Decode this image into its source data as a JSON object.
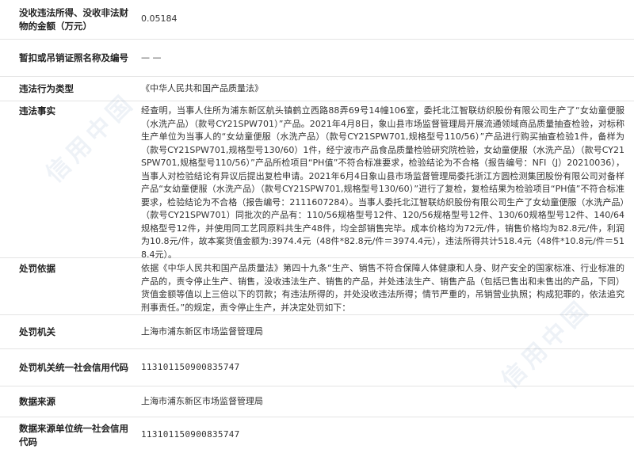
{
  "fields": [
    {
      "label": "没收违法所得、没收非法财物的金额（万元）",
      "value": "0.05184"
    },
    {
      "label": "暂扣或吊销证照名称及编号",
      "value": "— —"
    },
    {
      "label": "违法行为类型",
      "value": "《中华人民共和国产品质量法》"
    },
    {
      "label": "违法事实",
      "value": "经查明，当事人住所为浦东新区航头镇鹤立西路88弄69号14幢106室，委托北江智联纺织股份有限公司生产了“女幼童便服（水洗产品）（款号CY21SPW701）”产品。2021年4月8日，象山县市场监督管理局开展流通领域商品质量抽查检验，对标称生产单位为当事人的“女幼童便服（水洗产品）（款号CY21SPW701,规格型号110/56）”产品进行购买抽查检验1件，备样为（款号CY21SPW701,规格型号130/60）1件，经宁波市产品食品质量检验研究院检验，女幼童便服（水洗产品）（款号CY21SPW701,规格型号110/56）”产品所检项目“PH值”不符合标准要求，检验结论为不合格（报告编号：NFI（J）20210036），当事人对检验结论有异议后提出复检申请。2021年6月4日象山县市场监督管理局委托浙江方圆检测集团股份有限公司对备样产品“女幼童便服（水洗产品）（款号CY21SPW701,规格型号130/60）”进行了复检，复检结果为检验项目“PH值”不符合标准要求，检验结论为不合格（报告编号：2111607284）。当事人委托北江智联纺织股份有限公司生产了女幼童便服（水洗产品）（款号CY21SPW701）同批次的产品有：110/56规格型号12件、120/56规格型号12件、130/60规格型号12件、140/64规格型号12件，并使用同工艺同原料共生产48件，均全部销售完毕。成本价格均为72元/件，销售价格均为82.8元/件，利润为10.8元/件，故本案货值金额为:3974.4元（48件*82.8元/件＝3974.4元），违法所得共计518.4元（48件*10.8元/件＝518.4元）。"
    },
    {
      "label": "处罚依据",
      "value": "依据《中华人民共和国产品质量法》第四十九条“生产、销售不符合保障人体健康和人身、财产安全的国家标准、行业标准的产品的，责令停止生产、销售，没收违法生产、销售的产品，并处违法生产、销售产品（包括已售出和未售出的产品，下同）货值金额等值以上三倍以下的罚款；有违法所得的，并处没收违法所得；情节严重的，吊销营业执照；构成犯罪的，依法追究刑事责任。”的规定，责令停止生产，并决定处罚如下："
    },
    {
      "label": "处罚机关",
      "value": "上海市浦东新区市场监督管理局"
    },
    {
      "label": "处罚机关统一社会信用代码",
      "value": "113101150900835747"
    },
    {
      "label": "数据来源",
      "value": "上海市浦东新区市场监督管理局"
    },
    {
      "label": "数据来源单位统一社会信用代码",
      "value": "113101150900835747"
    }
  ],
  "watermark": {
    "text": "信用中国"
  }
}
